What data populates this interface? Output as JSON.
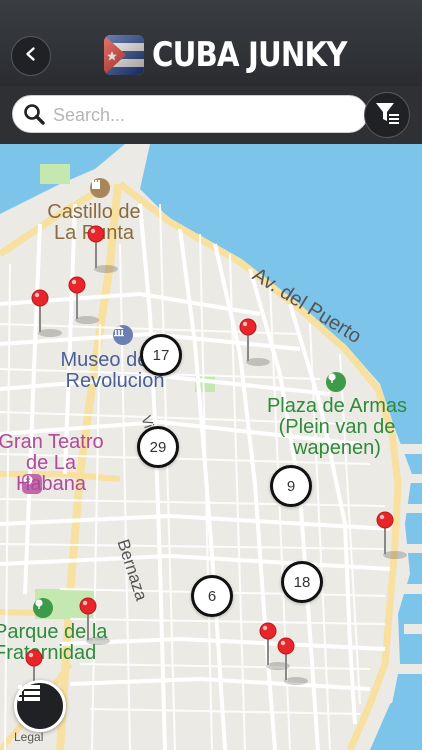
{
  "header": {
    "app_title": "CUBA JUNKY",
    "back_icon": "chevron-left-icon",
    "logo_icon": "cuba-flag-icon"
  },
  "search": {
    "placeholder": "Search...",
    "value": "",
    "filter_icon": "filter-list-icon"
  },
  "map": {
    "labels": {
      "castillo": "Castillo de La Punta",
      "museo": "Museo de la Revolucion",
      "teatro": "Gran Teatro de La Habana",
      "plaza": "Plaza de Armas (Plein van de wapenen)",
      "parque": "Parque de la Fraternidad",
      "av_puerto": "Av. del Puerto",
      "villegas": "Villegas",
      "bernaza": "Bernaza",
      "legal": "Legal"
    },
    "clusters": [
      {
        "count": "17"
      },
      {
        "count": "29"
      },
      {
        "count": "9"
      },
      {
        "count": "6"
      },
      {
        "count": "18"
      }
    ],
    "pin_color": "#e8262a",
    "water_color": "#7cc4ea",
    "park_color": "#c5e8b0"
  },
  "list_button_icon": "list-icon"
}
